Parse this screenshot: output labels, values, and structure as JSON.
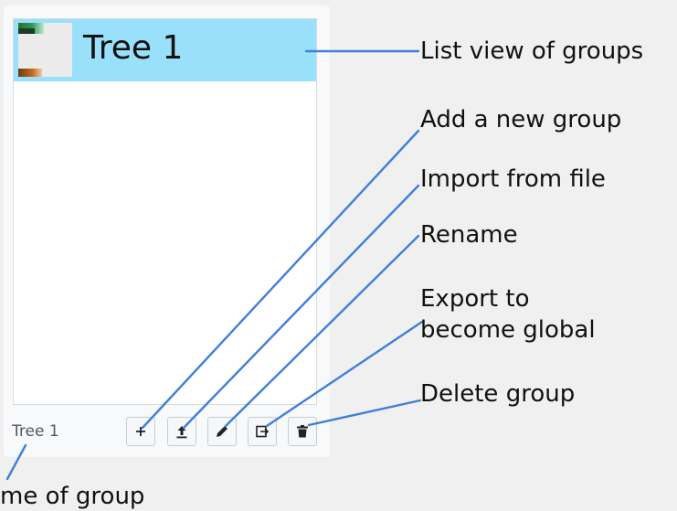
{
  "list": {
    "items": [
      {
        "label": "Tree 1",
        "thumbnail_icon": "tree-thumbnail-image"
      }
    ]
  },
  "selected_group_name": "Tree 1",
  "toolbar": {
    "buttons": [
      {
        "name": "add",
        "icon": "plus-icon"
      },
      {
        "name": "import",
        "icon": "upload-icon"
      },
      {
        "name": "rename",
        "icon": "pencil-icon"
      },
      {
        "name": "export",
        "icon": "export-icon"
      },
      {
        "name": "delete",
        "icon": "trash-icon"
      }
    ]
  },
  "annotations": {
    "list_view": "List view of groups",
    "add": "Add a new group",
    "import": "Import from file",
    "rename": "Rename",
    "export_line1": "Export to",
    "export_line2": "become global",
    "delete": "Delete group",
    "name_of_group": "me of group"
  },
  "colors": {
    "selection": "#99e0fb",
    "leader_line": "#3f7fd9"
  }
}
